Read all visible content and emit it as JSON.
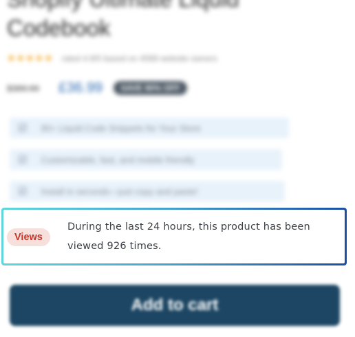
{
  "product": {
    "title": "Shopify Ultimate Liquid Codebook",
    "rating_stars": "★★★★★",
    "rating_text": "rated 4.9/5 based on 4068 website owners",
    "old_price": "$389.99",
    "sale_price": "£36.99",
    "sale_badge": "SAVE 90% OFF"
  },
  "features": [
    {
      "icon": "checkbox-icon",
      "label": "90+ Liquid Code Snippets for Your Store"
    },
    {
      "icon": "checkbox-icon",
      "label": "Customizable, fast, and mobile friendly"
    },
    {
      "icon": "checkbox-icon",
      "label": "Install in seconds—just copy and paste!"
    }
  ],
  "views": {
    "badge": "Views",
    "message": "During the last 24 hours, this product has been viewed 926 times.",
    "colors": {
      "badge_bg": "#f7dfdc",
      "badge_text": "#c2362b",
      "border_start": "#60d6da",
      "border_end": "#1a4fa2"
    }
  },
  "cart": {
    "button_label": "Add to cart",
    "button_color": "#1c4663"
  }
}
